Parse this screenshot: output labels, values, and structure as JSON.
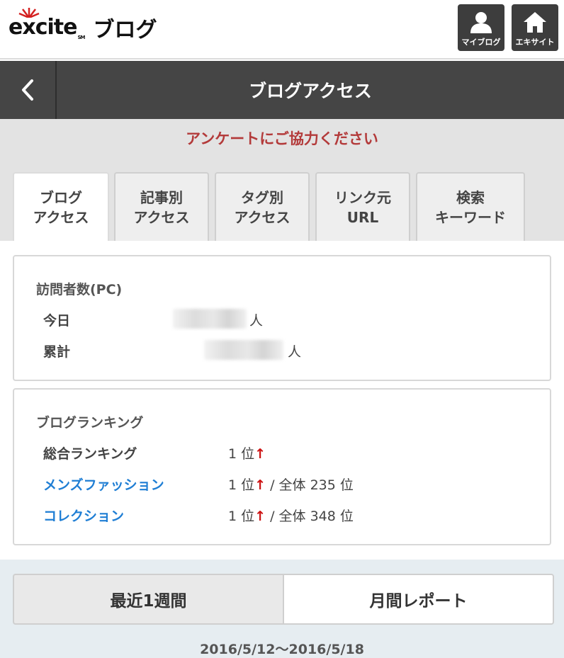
{
  "header": {
    "logo_text": "excite",
    "logo_sm": "SM",
    "logo_suffix": "ブログ",
    "myblog_label": "マイブログ",
    "excite_label": "エキサイト"
  },
  "titlebar": {
    "title": "ブログアクセス"
  },
  "survey_link": "アンケートにご協力ください",
  "tabs": [
    {
      "line1": "ブログ",
      "line2": "アクセス"
    },
    {
      "line1": "記事別",
      "line2": "アクセス"
    },
    {
      "line1": "タグ別",
      "line2": "アクセス"
    },
    {
      "line1": "リンク元",
      "line2": "URL"
    },
    {
      "line1": "検索",
      "line2": "キーワード"
    }
  ],
  "visitors": {
    "title": "訪問者数(PC)",
    "today_label": "今日",
    "total_label": "累計",
    "unit": "人"
  },
  "ranking": {
    "title": "ブログランキング",
    "rows": [
      {
        "label": "総合ランキング",
        "rank": "1 位",
        "arrow": "↑",
        "overall": ""
      },
      {
        "label": "メンズファッション",
        "rank": "1 位",
        "arrow": "↑",
        "overall": " / 全体 235 位"
      },
      {
        "label": "コレクション",
        "rank": "1 位",
        "arrow": "↑",
        "overall": " / 全体 348 位"
      }
    ]
  },
  "period": {
    "week_label": "最近1週間",
    "month_label": "月間レポート",
    "date_range": "2016/5/12〜2016/5/18"
  },
  "colors": {
    "header_dark": "#454545",
    "survey_red": "#b33a3a",
    "link_blue": "#1f7ed4",
    "arrow_red": "#cc1111"
  }
}
